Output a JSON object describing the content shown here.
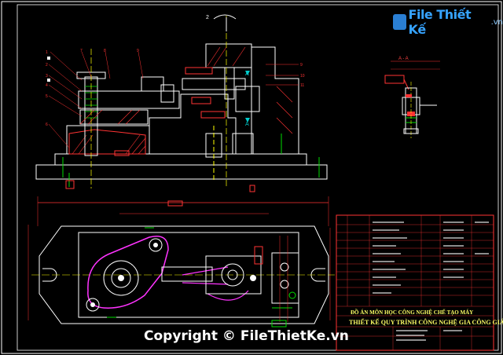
{
  "watermark": {
    "logo_text": "File Thiết Kế",
    "logo_suffix": ".vn",
    "copyright": "Copyright © FileThietKe.vn"
  },
  "drawing": {
    "section_label": "A - A",
    "title_block_line1": "ĐỒ ÁN MÔN HỌC CÔNG NGHỆ CHẾ TẠO MÁY",
    "title_block_line2": "THIẾT KẾ QUY TRÌNH CÔNG NGHỆ GIA CÔNG GIÁ ĐỠ"
  },
  "colors": {
    "background": "#000000",
    "outline": "#ffffff",
    "dimension": "#ff3333",
    "centerline": "#ffff00",
    "part_highlight": "#ff33ff",
    "hatch": "#ff3333",
    "green": "#00dd00",
    "cyan": "#00cccc"
  }
}
